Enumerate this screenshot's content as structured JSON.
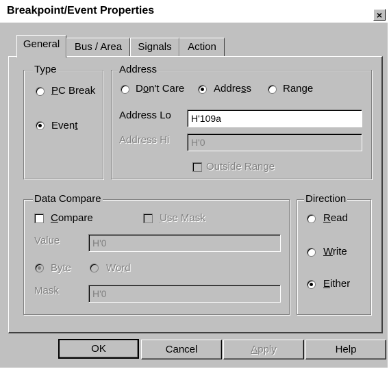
{
  "window": {
    "title": "Breakpoint/Event Properties",
    "close_glyph": "×"
  },
  "tabs": [
    {
      "label": "General",
      "active": true
    },
    {
      "label": "Bus / Area",
      "active": false
    },
    {
      "label": "Signals",
      "active": false
    },
    {
      "label": "Action",
      "active": false
    }
  ],
  "type_group": {
    "legend": "Type",
    "options": [
      {
        "pre": "",
        "u": "P",
        "post": "C Break",
        "selected": false
      },
      {
        "pre": "Even",
        "u": "t",
        "post": "",
        "selected": true
      }
    ]
  },
  "address_group": {
    "legend": "Address",
    "options": [
      {
        "pre": "D",
        "u": "o",
        "post": "n't Care",
        "selected": false
      },
      {
        "pre": "Addre",
        "u": "s",
        "post": "s",
        "selected": true
      },
      {
        "pre": "Range",
        "u": "",
        "post": "",
        "selected": false
      }
    ],
    "address_lo_label": "Address Lo",
    "address_lo_value": "H'109a",
    "address_hi_label": "Address Hi",
    "address_hi_value": "H'0",
    "outside_range_label": "Outside Range"
  },
  "data_compare_group": {
    "legend": "Data Compare",
    "compare": {
      "pre": "",
      "u": "C",
      "post": "ompare"
    },
    "use_mask": {
      "pre": "",
      "u": "U",
      "post": "se Mask"
    },
    "value_label": "Value",
    "value_value": "H'0",
    "byte": {
      "pre": "B",
      "u": "y",
      "post": "te"
    },
    "word": {
      "pre": "Wo",
      "u": "r",
      "post": "d"
    },
    "mask_label": "Mask",
    "mask_value": "H'0"
  },
  "direction_group": {
    "legend": "Direction",
    "options": [
      {
        "pre": "",
        "u": "R",
        "post": "ead",
        "selected": false
      },
      {
        "pre": "",
        "u": "W",
        "post": "rite",
        "selected": false
      },
      {
        "pre": "",
        "u": "E",
        "post": "ither",
        "selected": true
      }
    ]
  },
  "buttons": {
    "ok": "OK",
    "cancel": "Cancel",
    "apply": {
      "pre": "",
      "u": "A",
      "post": "pply"
    },
    "help": "Help"
  }
}
